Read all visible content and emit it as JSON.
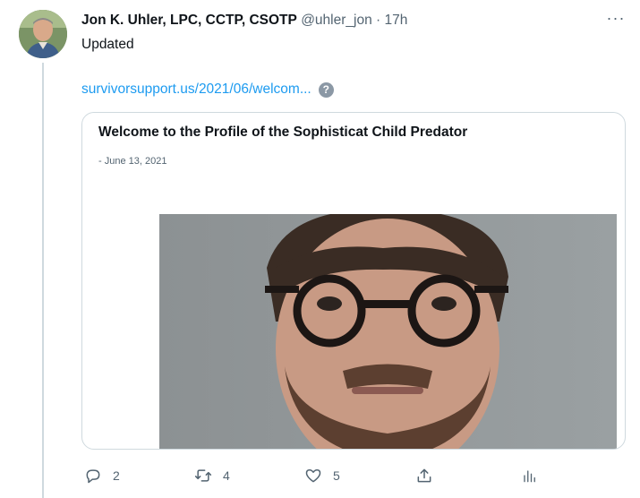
{
  "tweet": {
    "author": {
      "display_name": "Jon K. Uhler, LPC, CCTP, CSOTP",
      "handle": "@uhler_jon",
      "separator": "·",
      "time": "17h"
    },
    "more_label": "···",
    "text": "Updated",
    "link_text": "survivorsupport.us/2021/06/welcom...",
    "help_icon_label": "?",
    "card": {
      "title": "Welcome to the Profile of the Sophisticat Child Predator",
      "date": "- June 13, 2021"
    },
    "actions": {
      "reply": {
        "count": "2",
        "icon": "reply-icon"
      },
      "retweet": {
        "count": "4",
        "icon": "retweet-icon"
      },
      "like": {
        "count": "5",
        "icon": "heart-icon"
      },
      "share": {
        "icon": "share-icon"
      },
      "analytics": {
        "icon": "analytics-icon"
      }
    }
  },
  "colors": {
    "link": "#1d9bf0",
    "secondary_text": "#536471",
    "border": "#cfd9de"
  }
}
